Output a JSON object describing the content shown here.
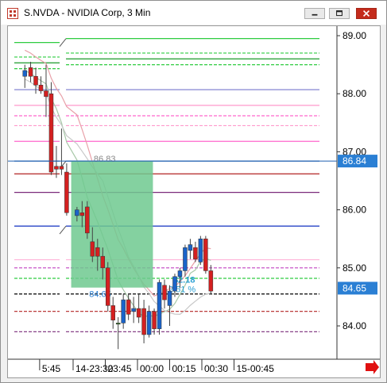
{
  "window": {
    "title": "S.NVDA - NVIDIA Corp, 3 Min"
  },
  "icons": {
    "app": "app-grid-icon",
    "minimize": "minimize-icon",
    "maximize": "maximize-icon",
    "close": "close-icon",
    "scroll_right": "arrow-right-icon"
  },
  "colors": {
    "up_candle": "#1a63c9",
    "down_candle": "#d42020",
    "neutral_candle": "#3a7a2a",
    "box_fill": "#6fc98f",
    "price_tag_bg": "#2a7fd4",
    "last_price_line": "#1f5fb0"
  },
  "chart_data": {
    "type": "candlestick",
    "symbol": "NVDA",
    "interval": "3 Min",
    "y_ticks": [
      "89.00",
      "88.00",
      "87.00",
      "86.00",
      "85.00",
      "84.00"
    ],
    "y_tick_values": [
      89,
      88,
      87,
      86,
      85,
      84
    ],
    "ylim": [
      83.5,
      89.25
    ],
    "x_ticks": [
      "5:45",
      "14-23:30",
      "23:45",
      "00:00",
      "00:15",
      "00:30",
      "15-00:45"
    ],
    "x_tick_index": [
      -5.2,
      0,
      5,
      10,
      15,
      20,
      25
    ],
    "price_tags": [
      {
        "label": "86.84",
        "value": 86.84
      },
      {
        "label": "84.65",
        "value": 84.65
      }
    ],
    "candles": [
      {
        "i": -7.5,
        "o": 88.3,
        "h": 88.5,
        "l": 88.1,
        "c": 88.4
      },
      {
        "i": -6.6,
        "o": 88.45,
        "h": 88.55,
        "l": 88.2,
        "c": 88.3
      },
      {
        "i": -5.8,
        "o": 88.3,
        "h": 88.45,
        "l": 88.0,
        "c": 88.15
      },
      {
        "i": -5.0,
        "o": 88.15,
        "h": 88.3,
        "l": 88.0,
        "c": 88.05
      },
      {
        "i": -4.2,
        "o": 88.05,
        "h": 88.5,
        "l": 87.6,
        "c": 87.95
      },
      {
        "i": -3.4,
        "o": 88.0,
        "h": 88.2,
        "l": 86.6,
        "c": 86.65
      },
      {
        "i": -2.6,
        "o": 86.75,
        "h": 87.1,
        "l": 86.55,
        "c": 86.7
      },
      {
        "i": -1.8,
        "o": 86.75,
        "h": 87.4,
        "l": 86.6,
        "c": 86.7
      },
      {
        "i": -1.0,
        "o": 86.65,
        "h": 86.8,
        "l": 85.9,
        "c": 85.95
      },
      {
        "i": 0.6,
        "o": 85.9,
        "h": 86.05,
        "l": 85.8,
        "c": 86.0
      },
      {
        "i": 1.4,
        "o": 85.95,
        "h": 86.15,
        "l": 85.7,
        "c": 85.9
      },
      {
        "i": 2.2,
        "o": 86.05,
        "h": 86.15,
        "l": 85.5,
        "c": 85.6
      },
      {
        "i": 3.0,
        "o": 85.45,
        "h": 85.7,
        "l": 85.1,
        "c": 85.2
      },
      {
        "i": 3.8,
        "o": 85.35,
        "h": 85.5,
        "l": 84.95,
        "c": 85.2
      },
      {
        "i": 4.6,
        "o": 85.2,
        "h": 85.35,
        "l": 84.8,
        "c": 85.0
      },
      {
        "i": 5.4,
        "o": 85.0,
        "h": 85.1,
        "l": 84.25,
        "c": 84.35
      },
      {
        "i": 6.2,
        "o": 84.35,
        "h": 84.5,
        "l": 83.95,
        "c": 84.1
      },
      {
        "i": 7.0,
        "o": 84.05,
        "h": 84.15,
        "l": 83.6,
        "c": 84.05
      },
      {
        "i": 7.8,
        "o": 84.05,
        "h": 84.55,
        "l": 83.95,
        "c": 84.45
      },
      {
        "i": 8.6,
        "o": 84.45,
        "h": 84.55,
        "l": 84.1,
        "c": 84.2
      },
      {
        "i": 9.4,
        "o": 84.25,
        "h": 84.5,
        "l": 84.05,
        "c": 84.3
      },
      {
        "i": 10.2,
        "o": 84.3,
        "h": 84.55,
        "l": 84.05,
        "c": 84.15
      },
      {
        "i": 11.0,
        "o": 84.3,
        "h": 84.45,
        "l": 83.7,
        "c": 83.85
      },
      {
        "i": 11.8,
        "o": 83.85,
        "h": 84.35,
        "l": 83.8,
        "c": 84.25
      },
      {
        "i": 12.6,
        "o": 84.25,
        "h": 84.3,
        "l": 83.85,
        "c": 83.95
      },
      {
        "i": 13.4,
        "o": 83.95,
        "h": 84.8,
        "l": 83.85,
        "c": 84.75
      },
      {
        "i": 14.2,
        "o": 84.7,
        "h": 84.8,
        "l": 84.3,
        "c": 84.45
      },
      {
        "i": 15.0,
        "o": 84.35,
        "h": 84.7,
        "l": 84.0,
        "c": 84.6
      },
      {
        "i": 15.8,
        "o": 84.6,
        "h": 84.9,
        "l": 84.5,
        "c": 84.85
      },
      {
        "i": 16.6,
        "o": 84.85,
        "h": 85.0,
        "l": 84.65,
        "c": 84.95
      },
      {
        "i": 17.4,
        "o": 84.95,
        "h": 85.4,
        "l": 84.85,
        "c": 85.35
      },
      {
        "i": 18.2,
        "o": 85.3,
        "h": 85.5,
        "l": 85.15,
        "c": 85.4
      },
      {
        "i": 19.0,
        "o": 85.35,
        "h": 85.45,
        "l": 85.1,
        "c": 85.15
      },
      {
        "i": 19.8,
        "o": 85.1,
        "h": 85.55,
        "l": 85.05,
        "c": 85.5
      },
      {
        "i": 20.6,
        "o": 85.5,
        "h": 85.55,
        "l": 84.9,
        "c": 84.95
      },
      {
        "i": 21.4,
        "o": 84.95,
        "h": 85.05,
        "l": 84.55,
        "c": 84.6
      }
    ],
    "box": {
      "from_index": -0.3,
      "to_index": 12.4,
      "top": 86.84,
      "bottom": 84.66,
      "label_top": "86.83",
      "label_bottom": "84.65",
      "label_change": "$2.18",
      "label_pct": "2.51 %"
    },
    "levels": [
      {
        "value": 88.95,
        "color": "#2ecc40",
        "style": "solid"
      },
      {
        "value": 88.7,
        "color": "#2ecc40",
        "style": "dashed"
      },
      {
        "value": 88.6,
        "color": "#1a9a2a",
        "style": "solid"
      },
      {
        "value": 88.5,
        "color": "#2ecc40",
        "style": "dashed"
      },
      {
        "value": 88.07,
        "color": "#7777cc",
        "style": "solid"
      },
      {
        "value": 87.8,
        "color": "#ff99cc",
        "style": "solid"
      },
      {
        "value": 87.62,
        "color": "#ff66cc",
        "style": "dashed"
      },
      {
        "value": 87.45,
        "color": "#ff99cc",
        "style": "dashed"
      },
      {
        "value": 87.18,
        "color": "#ff66cc",
        "style": "solid"
      },
      {
        "value": 86.84,
        "color": "#1f5fb0",
        "style": "solid"
      },
      {
        "value": 86.62,
        "color": "#b22222",
        "style": "solid"
      },
      {
        "value": 86.3,
        "color": "#7a2a7a",
        "style": "solid"
      },
      {
        "value": 85.72,
        "color": "#1030c0",
        "style": "solid"
      },
      {
        "value": 85.14,
        "color": "#ffb3d9",
        "style": "solid"
      },
      {
        "value": 85.0,
        "color": "#c040c0",
        "style": "dashed"
      },
      {
        "value": 84.82,
        "color": "#2ecc40",
        "style": "dashed"
      },
      {
        "value": 84.55,
        "color": "#000000",
        "style": "dashed"
      },
      {
        "value": 84.25,
        "color": "#b22222",
        "style": "dashed"
      },
      {
        "value": 83.9,
        "color": "#7a2a7a",
        "style": "dashed"
      }
    ]
  }
}
